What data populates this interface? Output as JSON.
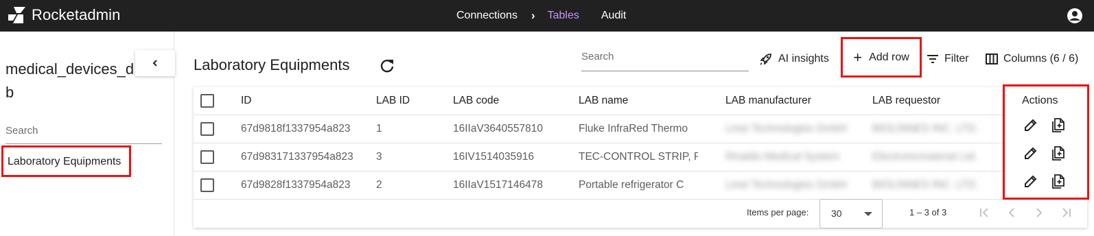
{
  "app": {
    "name": "Rocketadmin"
  },
  "nav": {
    "connections": "Connections",
    "tables": "Tables",
    "audit": "Audit"
  },
  "sidebar": {
    "db_name": "medical_devices_db",
    "search_placeholder": "Search",
    "items": [
      {
        "label": "Laboratory Equipments"
      }
    ]
  },
  "main": {
    "title": "Laboratory Equipments",
    "search_placeholder": "Search",
    "toolbar": {
      "ai_insights": "AI insights",
      "add_row": "Add row",
      "filter": "Filter",
      "columns": "Columns (6 / 6)"
    }
  },
  "table": {
    "headers": [
      "ID",
      "LAB ID",
      "LAB code",
      "LAB name",
      "LAB manufacturer",
      "LAB requestor",
      "Actions"
    ],
    "rows": [
      {
        "id": "67d9818f1337954a823",
        "lab_id": "1",
        "lab_code": "16IIaV3640557810",
        "lab_name": "Fluke InfraRed Thermo",
        "manufacturer": "Linet Technologies GmbH",
        "requestor": "BIOLINNES INC. LTD."
      },
      {
        "id": "67d983171337954a823",
        "lab_id": "3",
        "lab_code": "16IV1514035916",
        "lab_name": "TEC-CONTROL STRIP, R",
        "manufacturer": "Rinaldo Medical System",
        "requestor": "Electronicmaterial Ltd."
      },
      {
        "id": "67d9828f1337954a823",
        "lab_id": "2",
        "lab_code": "16IIaV1517146478",
        "lab_name": "Portable refrigerator C",
        "manufacturer": "Linet Technologies GmbH",
        "requestor": "BIOLINNES INC. LTD."
      }
    ]
  },
  "pagination": {
    "items_per_page_label": "Items per page:",
    "items_per_page": "30",
    "range": "1 – 3 of 3"
  },
  "colors": {
    "topbar": "#212121",
    "active_nav": "#c792ff",
    "highlight": "#ee1111"
  }
}
